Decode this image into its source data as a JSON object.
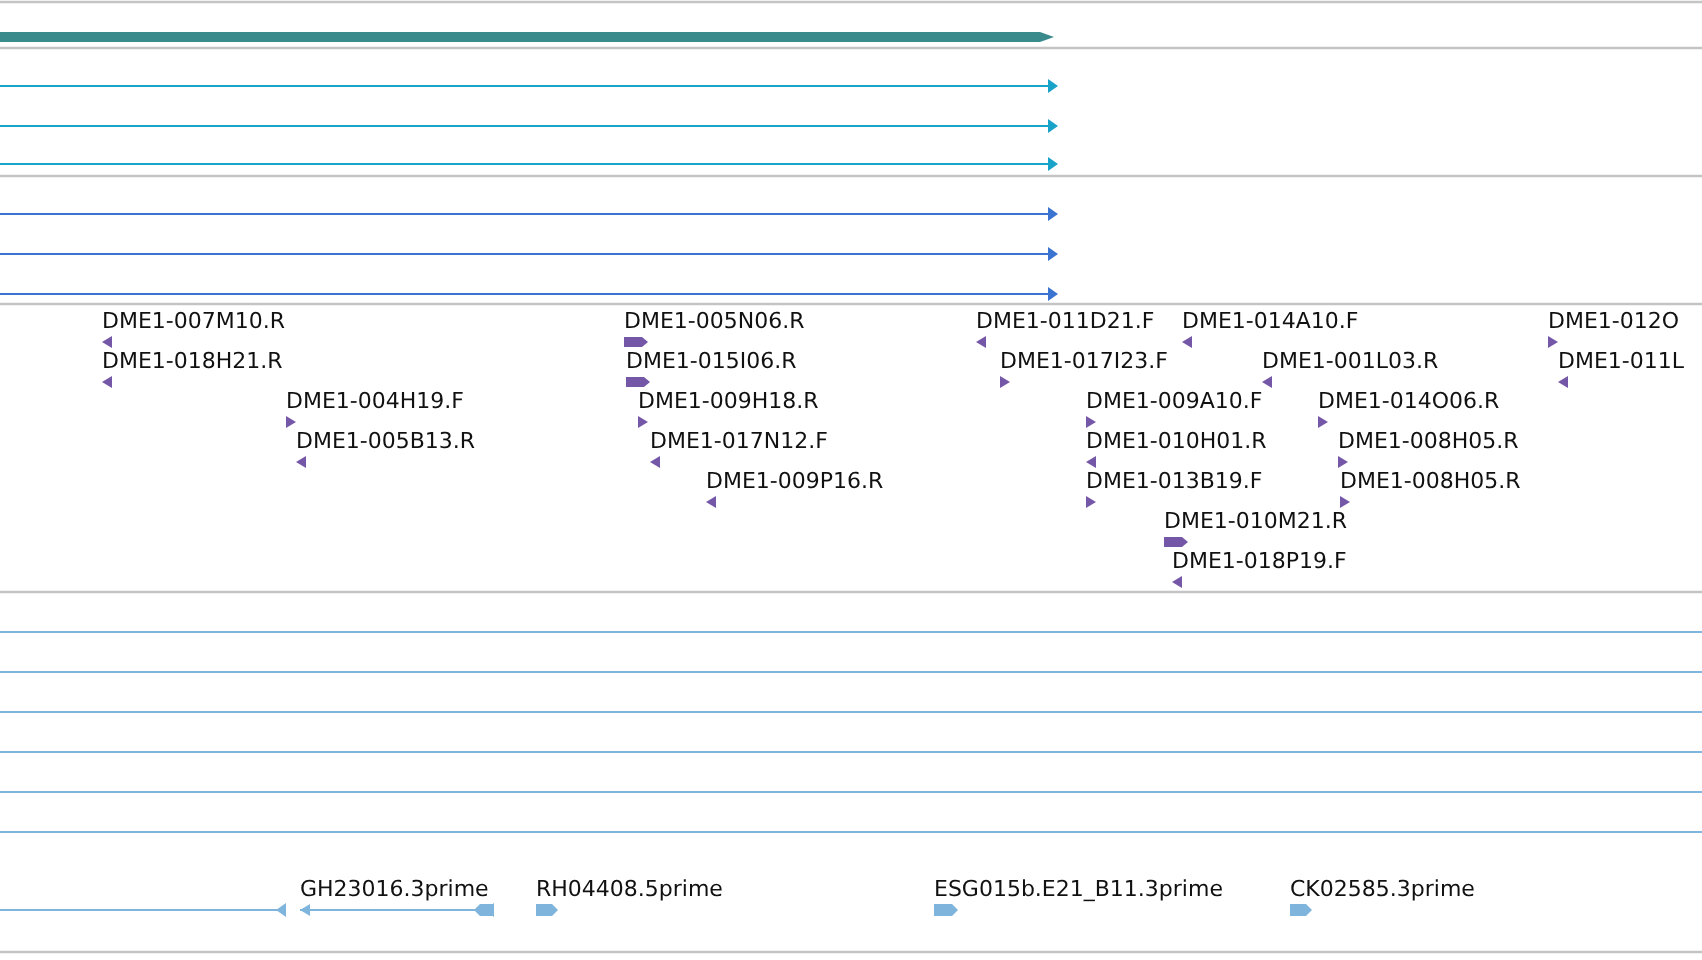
{
  "tracks": [
    {
      "kind": "thick",
      "color": "#3a8a8c",
      "features": [
        {
          "reverse": false
        }
      ]
    },
    {
      "kind": "lines",
      "color": "#1aa3c8",
      "features": [
        {
          "reverse": false
        },
        {
          "reverse": false
        },
        {
          "reverse": false
        }
      ]
    },
    {
      "kind": "lines",
      "color": "#3b73d1",
      "features": [
        {
          "reverse": false
        },
        {
          "reverse": false
        },
        {
          "reverse": false
        }
      ]
    },
    {
      "kind": "labeled",
      "color": "#7557a8",
      "features": [
        {
          "label": "DME1-007M10.R",
          "reverse": true
        },
        {
          "label": "DME1-005N06.R",
          "reverse": false
        },
        {
          "label": "DME1-011D21.F",
          "reverse": true
        },
        {
          "label": "DME1-014A10.F",
          "reverse": true
        },
        {
          "label": "DME1-012O",
          "reverse": false
        },
        {
          "label": "DME1-018H21.R",
          "reverse": true
        },
        {
          "label": "DME1-015I06.R",
          "reverse": false
        },
        {
          "label": "DME1-017I23.F",
          "reverse": false
        },
        {
          "label": "DME1-001L03.R",
          "reverse": true
        },
        {
          "label": "DME1-011L",
          "reverse": true
        },
        {
          "label": "DME1-004H19.F",
          "reverse": false
        },
        {
          "label": "DME1-009H18.R",
          "reverse": false
        },
        {
          "label": "DME1-009A10.F",
          "reverse": false
        },
        {
          "label": "DME1-014O06.R",
          "reverse": false
        },
        {
          "label": "DME1-005B13.R",
          "reverse": true
        },
        {
          "label": "DME1-017N12.F",
          "reverse": true
        },
        {
          "label": "DME1-010H01.R",
          "reverse": true
        },
        {
          "label": "DME1-008H05.R",
          "reverse": false
        },
        {
          "label": "DME1-009P16.R",
          "reverse": true
        },
        {
          "label": "DME1-013B19.F",
          "reverse": false
        },
        {
          "label": "DME1-008H05.R",
          "reverse": false
        },
        {
          "label": "DME1-010M21.R",
          "reverse": false
        },
        {
          "label": "DME1-018P19.F",
          "reverse": true
        }
      ]
    },
    {
      "kind": "spans",
      "color": "#7fb5dc",
      "features": [
        {
          "kind": "plain"
        },
        {
          "kind": "plain"
        },
        {
          "kind": "plain"
        },
        {
          "kind": "plain"
        },
        {
          "kind": "plain"
        },
        {
          "kind": "plain"
        },
        {
          "kind": "arrow",
          "reverse": true
        },
        {
          "kind": "arrow",
          "label": "GH23016.3prime",
          "reverse": true
        },
        {
          "kind": "arrow",
          "label": "RH04408.5prime",
          "reverse": false
        },
        {
          "kind": "arrow",
          "label": "ESG015b.E21_B11.3prime",
          "reverse": false
        },
        {
          "kind": "arrow",
          "label": "CK02585.3prime",
          "reverse": false
        }
      ]
    }
  ]
}
